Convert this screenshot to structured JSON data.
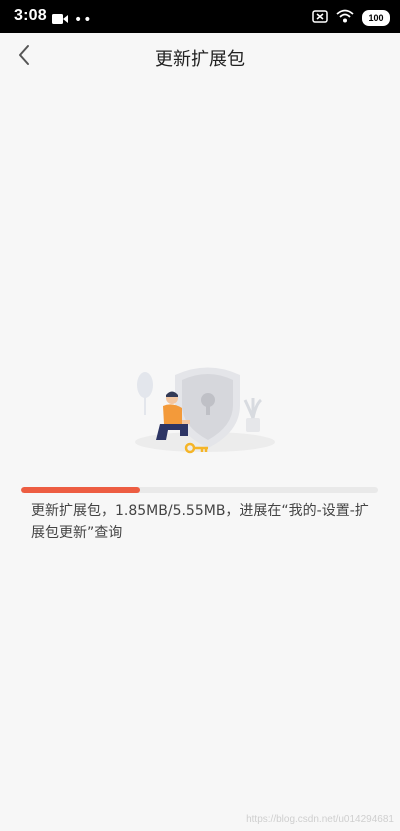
{
  "status_bar": {
    "time": "3:08",
    "dots": "••",
    "battery": "100",
    "icons": [
      "video-camera-icon",
      "sim-off-icon",
      "wifi-icon",
      "battery-icon"
    ]
  },
  "header": {
    "title": "更新扩展包",
    "back_icon": "chevron-left-icon"
  },
  "progress": {
    "downloaded": "1.85MB",
    "total": "5.55MB",
    "fraction": 0.333,
    "message": "更新扩展包，1.85MB/5.55MB，进展在“我的-设置-扩展包更新”查询",
    "fill_color": "#ed5d42"
  },
  "watermark": "https://blog.csdn.net/u014294681",
  "colors": {
    "accent": "#ed5d42",
    "background": "#f7f7f7",
    "key": "#f5b528",
    "shirt": "#f39a3a"
  }
}
